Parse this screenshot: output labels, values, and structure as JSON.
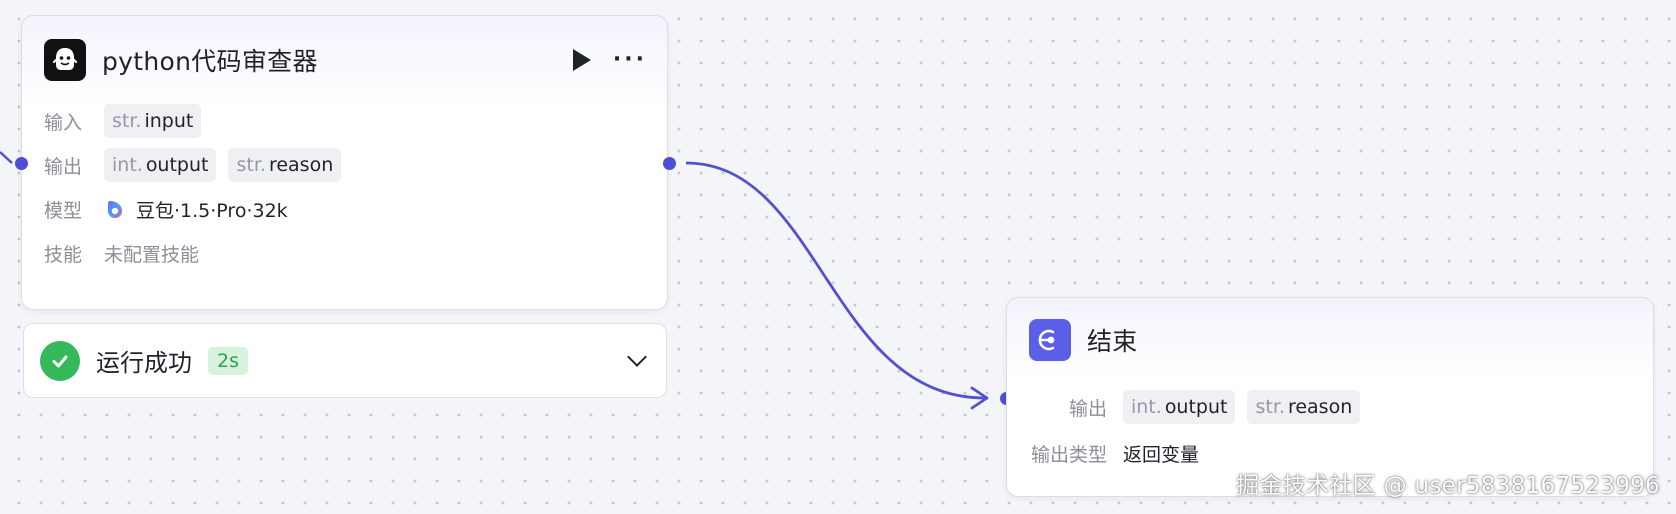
{
  "llm_node": {
    "title": "python代码审查器",
    "icon": "ghost-icon",
    "rows": {
      "input_label": "输入",
      "inputs": [
        {
          "type": "str.",
          "name": "input"
        }
      ],
      "output_label": "输出",
      "outputs": [
        {
          "type": "int.",
          "name": "output"
        },
        {
          "type": "str.",
          "name": "reason"
        }
      ],
      "model_label": "模型",
      "model_value": "豆包·1.5·Pro·32k",
      "skill_label": "技能",
      "skill_value": "未配置技能"
    }
  },
  "run_status": {
    "text": "运行成功",
    "duration": "2s",
    "color": "#35b85a"
  },
  "end_node": {
    "title": "结束",
    "icon": "end-node-icon",
    "output_label": "输出",
    "outputs": [
      {
        "type": "int.",
        "name": "output"
      },
      {
        "type": "str.",
        "name": "reason"
      }
    ],
    "output_type_label": "输出类型",
    "output_type_value": "返回变量"
  },
  "colors": {
    "accent": "#4c4fd6",
    "edge": "#5152cc"
  },
  "watermark": "掘金技术社区 @ user5838167523996"
}
